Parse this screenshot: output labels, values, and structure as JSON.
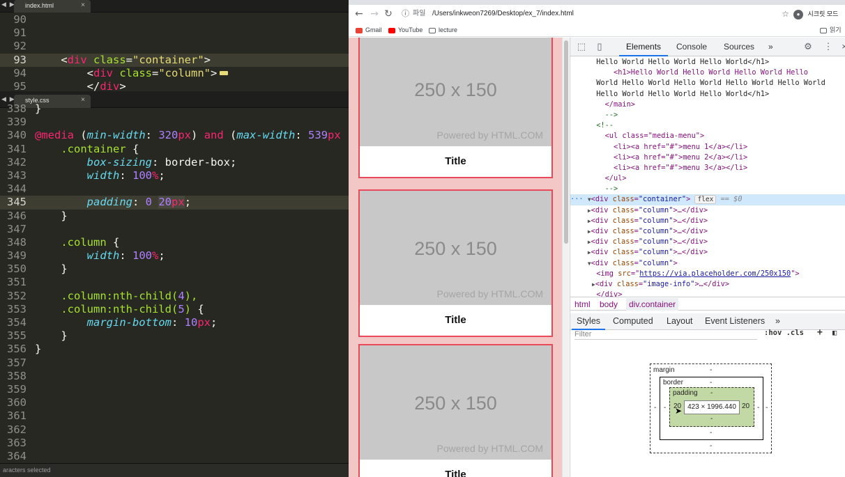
{
  "editor": {
    "top_tab": "index.html",
    "bottom_tab": "style.css",
    "status": "aracters selected",
    "html_lines": [
      {
        "n": "90",
        "code": ""
      },
      {
        "n": "91",
        "code": ""
      },
      {
        "n": "92",
        "code": ""
      },
      {
        "n": "93",
        "indent": "    ",
        "open": "<",
        "tag": "div",
        "attr": " class",
        "eq": "=",
        "value": "\"container\"",
        "close": ">"
      },
      {
        "n": "94",
        "indent": "        ",
        "open": "<",
        "tag": "div",
        "attr": " class",
        "eq": "=",
        "value": "\"column\"",
        "close": ">"
      },
      {
        "n": "95",
        "indent": "        ",
        "open": "</",
        "tag": "div",
        "close": ">"
      }
    ],
    "css_lines": [
      {
        "n": "338",
        "text": "}"
      },
      {
        "n": "339",
        "text": ""
      },
      {
        "n": "340",
        "media": "@media",
        "p1": " (",
        "feat1": "min-width",
        "c1": ": ",
        "num1": "320",
        "u1": "px",
        "p2": ") ",
        "and": "and",
        "p3": " (",
        "feat2": "max-width",
        "c2": ": ",
        "num2": "539",
        "u2": "px"
      },
      {
        "n": "341",
        "selector": "    .container",
        "brace": " {"
      },
      {
        "n": "342",
        "prop": "        box-sizing",
        "colon": ": ",
        "word": "border-box",
        "semi": ";"
      },
      {
        "n": "343",
        "prop": "        width",
        "colon": ": ",
        "num": "100",
        "unit": "%",
        "semi": ";"
      },
      {
        "n": "344",
        "text": ""
      },
      {
        "n": "345",
        "prop": "        padding",
        "colon": ": ",
        "num": "0",
        "sp": " ",
        "num2": "20",
        "unit2": "px",
        "semi": ";"
      },
      {
        "n": "346",
        "text": "    }"
      },
      {
        "n": "347",
        "text": ""
      },
      {
        "n": "348",
        "selector": "    .column",
        "brace": " {"
      },
      {
        "n": "349",
        "prop": "        width",
        "colon": ": ",
        "num": "100",
        "unit": "%",
        "semi": ";"
      },
      {
        "n": "350",
        "text": "    }"
      },
      {
        "n": "351",
        "text": ""
      },
      {
        "n": "352",
        "selector": "    .column",
        "pseudo": ":nth-child(",
        "arg": "4",
        "pclose": "),"
      },
      {
        "n": "353",
        "selector": "    .column",
        "pseudo": ":nth-child(",
        "arg": "5",
        "pclose": ")",
        "brace": " {"
      },
      {
        "n": "354",
        "prop": "        margin-bottom",
        "colon": ": ",
        "num": "10",
        "unit": "px",
        "semi": ";"
      },
      {
        "n": "355",
        "text": "    }"
      },
      {
        "n": "356",
        "text": "}"
      },
      {
        "n": "357",
        "text": ""
      },
      {
        "n": "358",
        "text": ""
      },
      {
        "n": "359",
        "text": ""
      },
      {
        "n": "360",
        "text": ""
      },
      {
        "n": "361",
        "text": ""
      },
      {
        "n": "362",
        "text": ""
      },
      {
        "n": "363",
        "text": ""
      },
      {
        "n": "364",
        "text": ""
      }
    ]
  },
  "browser": {
    "nav": {
      "back": "←",
      "forward": "→",
      "reload": "↻",
      "info": "ⓘ"
    },
    "url_scheme": "파일",
    "url": "/Users/inkweon7269/Desktop/ex_7/index.html",
    "profile": "시크릿 모드",
    "reading_list": "읽기",
    "bookmarks": [
      {
        "label": "Gmail",
        "color": "#ea4335"
      },
      {
        "label": "YouTube",
        "color": "#ff0000"
      },
      {
        "label": "lecture",
        "color": "#5f6368"
      }
    ],
    "cards": [
      {
        "dim": "250 x 150",
        "powered": "Powered by HTML.COM",
        "title": "Title"
      },
      {
        "dim": "250 x 150",
        "powered": "Powered by HTML.COM",
        "title": "Title"
      },
      {
        "dim": "250 x 150",
        "powered": "Powered by HTML.COM",
        "title": "Title"
      }
    ]
  },
  "devtools": {
    "tabs": [
      "Elements",
      "Console",
      "Sources",
      "»"
    ],
    "dom_rows": [
      {
        "indent": "      ",
        "text": "Hello World Hello World Hello World</h1>"
      },
      {
        "indent": "          ",
        "text": "<h1>Hello World Hello World Hello World Hello"
      },
      {
        "indent": "      ",
        "text": "World Hello World Hello World Hello World Hello World"
      },
      {
        "indent": "      ",
        "text": "Hello World Hello World Hello World</h1>"
      },
      {
        "indent": "        ",
        "text": "</main>"
      },
      {
        "indent": "        ",
        "text": "-->"
      },
      {
        "indent": "      ",
        "text": "<!--"
      },
      {
        "indent": "        ",
        "text": "<ul class=\"media-menu\">"
      },
      {
        "indent": "          ",
        "text": "<li><a href=\"#\">menu 1</a></li>"
      },
      {
        "indent": "          ",
        "text": "<li><a href=\"#\">menu 2</a></li>"
      },
      {
        "indent": "          ",
        "text": "<li><a href=\"#\">menu 3</a></li>"
      },
      {
        "indent": "        ",
        "text": "</ul>"
      },
      {
        "indent": "        ",
        "text": "-->"
      }
    ],
    "selected_row": {
      "dots": "···",
      "arrow": "▼",
      "tag_open": "<div",
      "attr": " class",
      "eq": "=",
      "value": "\"container\"",
      "tag_close": ">",
      "badge": "flex",
      "eqs": " == ",
      "ref": "$0"
    },
    "column_rows": [
      {
        "arrow": "▶",
        "tag_open": "<div",
        "attr": " class",
        "eq": "=",
        "value": "\"column\"",
        "rest": ">…</div>"
      },
      {
        "arrow": "▶",
        "tag_open": "<div",
        "attr": " class",
        "eq": "=",
        "value": "\"column\"",
        "rest": ">…</div>"
      },
      {
        "arrow": "▶",
        "tag_open": "<div",
        "attr": " class",
        "eq": "=",
        "value": "\"column\"",
        "rest": ">…</div>"
      },
      {
        "arrow": "▶",
        "tag_open": "<div",
        "attr": " class",
        "eq": "=",
        "value": "\"column\"",
        "rest": ">…</div>"
      },
      {
        "arrow": "▶",
        "tag_open": "<div",
        "attr": " class",
        "eq": "=",
        "value": "\"column\"",
        "rest": ">…</div>"
      },
      {
        "arrow": "▼",
        "tag_open": "<div",
        "attr": " class",
        "eq": "=",
        "value": "\"column\"",
        "rest": ">"
      }
    ],
    "img_row": {
      "tag_open": "<img",
      "attr": " src",
      "eq": "=",
      "link": "https://via.placeholder.com/250x150",
      "tag_close": ">"
    },
    "image_info_row": {
      "arrow": "▶",
      "tag_open": "<div",
      "attr": " class",
      "eq": "=",
      "value": "\"image-info\"",
      "rest": ">…</div>"
    },
    "last_row": "</div>",
    "breadcrumbs": [
      "html",
      "body",
      "div.container"
    ],
    "sub_tabs": [
      "Styles",
      "Computed",
      "Layout",
      "Event Listeners",
      "»"
    ],
    "filter_placeholder": "Filter",
    "filter_opts": ":hov .cls",
    "box_model": {
      "margin_label": "margin",
      "margin_top": "-",
      "margin_bottom": "-",
      "margin_left": "-",
      "margin_right": "-",
      "border_label": "border",
      "border_top": "-",
      "border_bottom": "-",
      "border_left": "-",
      "border_right": "-",
      "padding_label": "padding",
      "padding_top": "-",
      "padding_bottom": "-",
      "padding_left": "20",
      "padding_right": "20",
      "content": "423 × 1996.440"
    }
  }
}
